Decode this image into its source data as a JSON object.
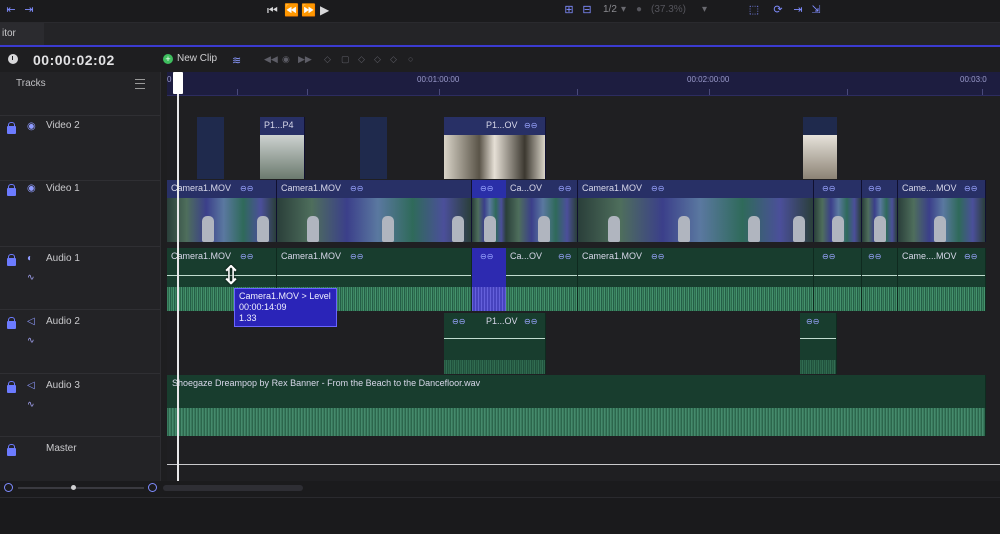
{
  "tabs": {
    "editor": "itor"
  },
  "toolbar": {
    "zoom_ratio": "1/2",
    "zoom_percent": "(37.3%)"
  },
  "timecode": "00:00:02:02",
  "new_clip_label": "New Clip",
  "ruler": {
    "labels": [
      "0",
      "00:01:00:00",
      "00:02:00:00",
      "00:03:0"
    ]
  },
  "tracks_header": "Tracks",
  "tracks": [
    {
      "name": "Video 2",
      "kind": "video"
    },
    {
      "name": "Video 1",
      "kind": "video"
    },
    {
      "name": "Audio 1",
      "kind": "audio"
    },
    {
      "name": "Audio 2",
      "kind": "audio"
    },
    {
      "name": "Audio 3",
      "kind": "audio"
    },
    {
      "name": "Master",
      "kind": "master"
    }
  ],
  "clips": {
    "video2": [
      "P1...P4",
      "P1...OV"
    ],
    "video1": [
      "Camera1.MOV",
      "Camera1.MOV",
      "Ca...OV",
      "Camera1.MOV",
      "Came....MOV"
    ],
    "audio1": [
      "Camera1.MOV",
      "Camera1.MOV",
      "Ca...OV",
      "Camera1.MOV",
      "Came....MOV"
    ],
    "audio2": [
      "P1...OV"
    ],
    "audio3": [
      "Shoegaze Dreampop by Rex Banner - From the Beach to the Dancefloor.wav"
    ]
  },
  "tooltip": {
    "line1": "Camera1.MOV > Level",
    "line2": "00:00:14:09",
    "line3": "1.33"
  },
  "colors": {
    "accent": "#3b3bd0",
    "video_clip": "#283066",
    "audio_clip": "#183d2e",
    "selection": "#2a2fa8"
  }
}
